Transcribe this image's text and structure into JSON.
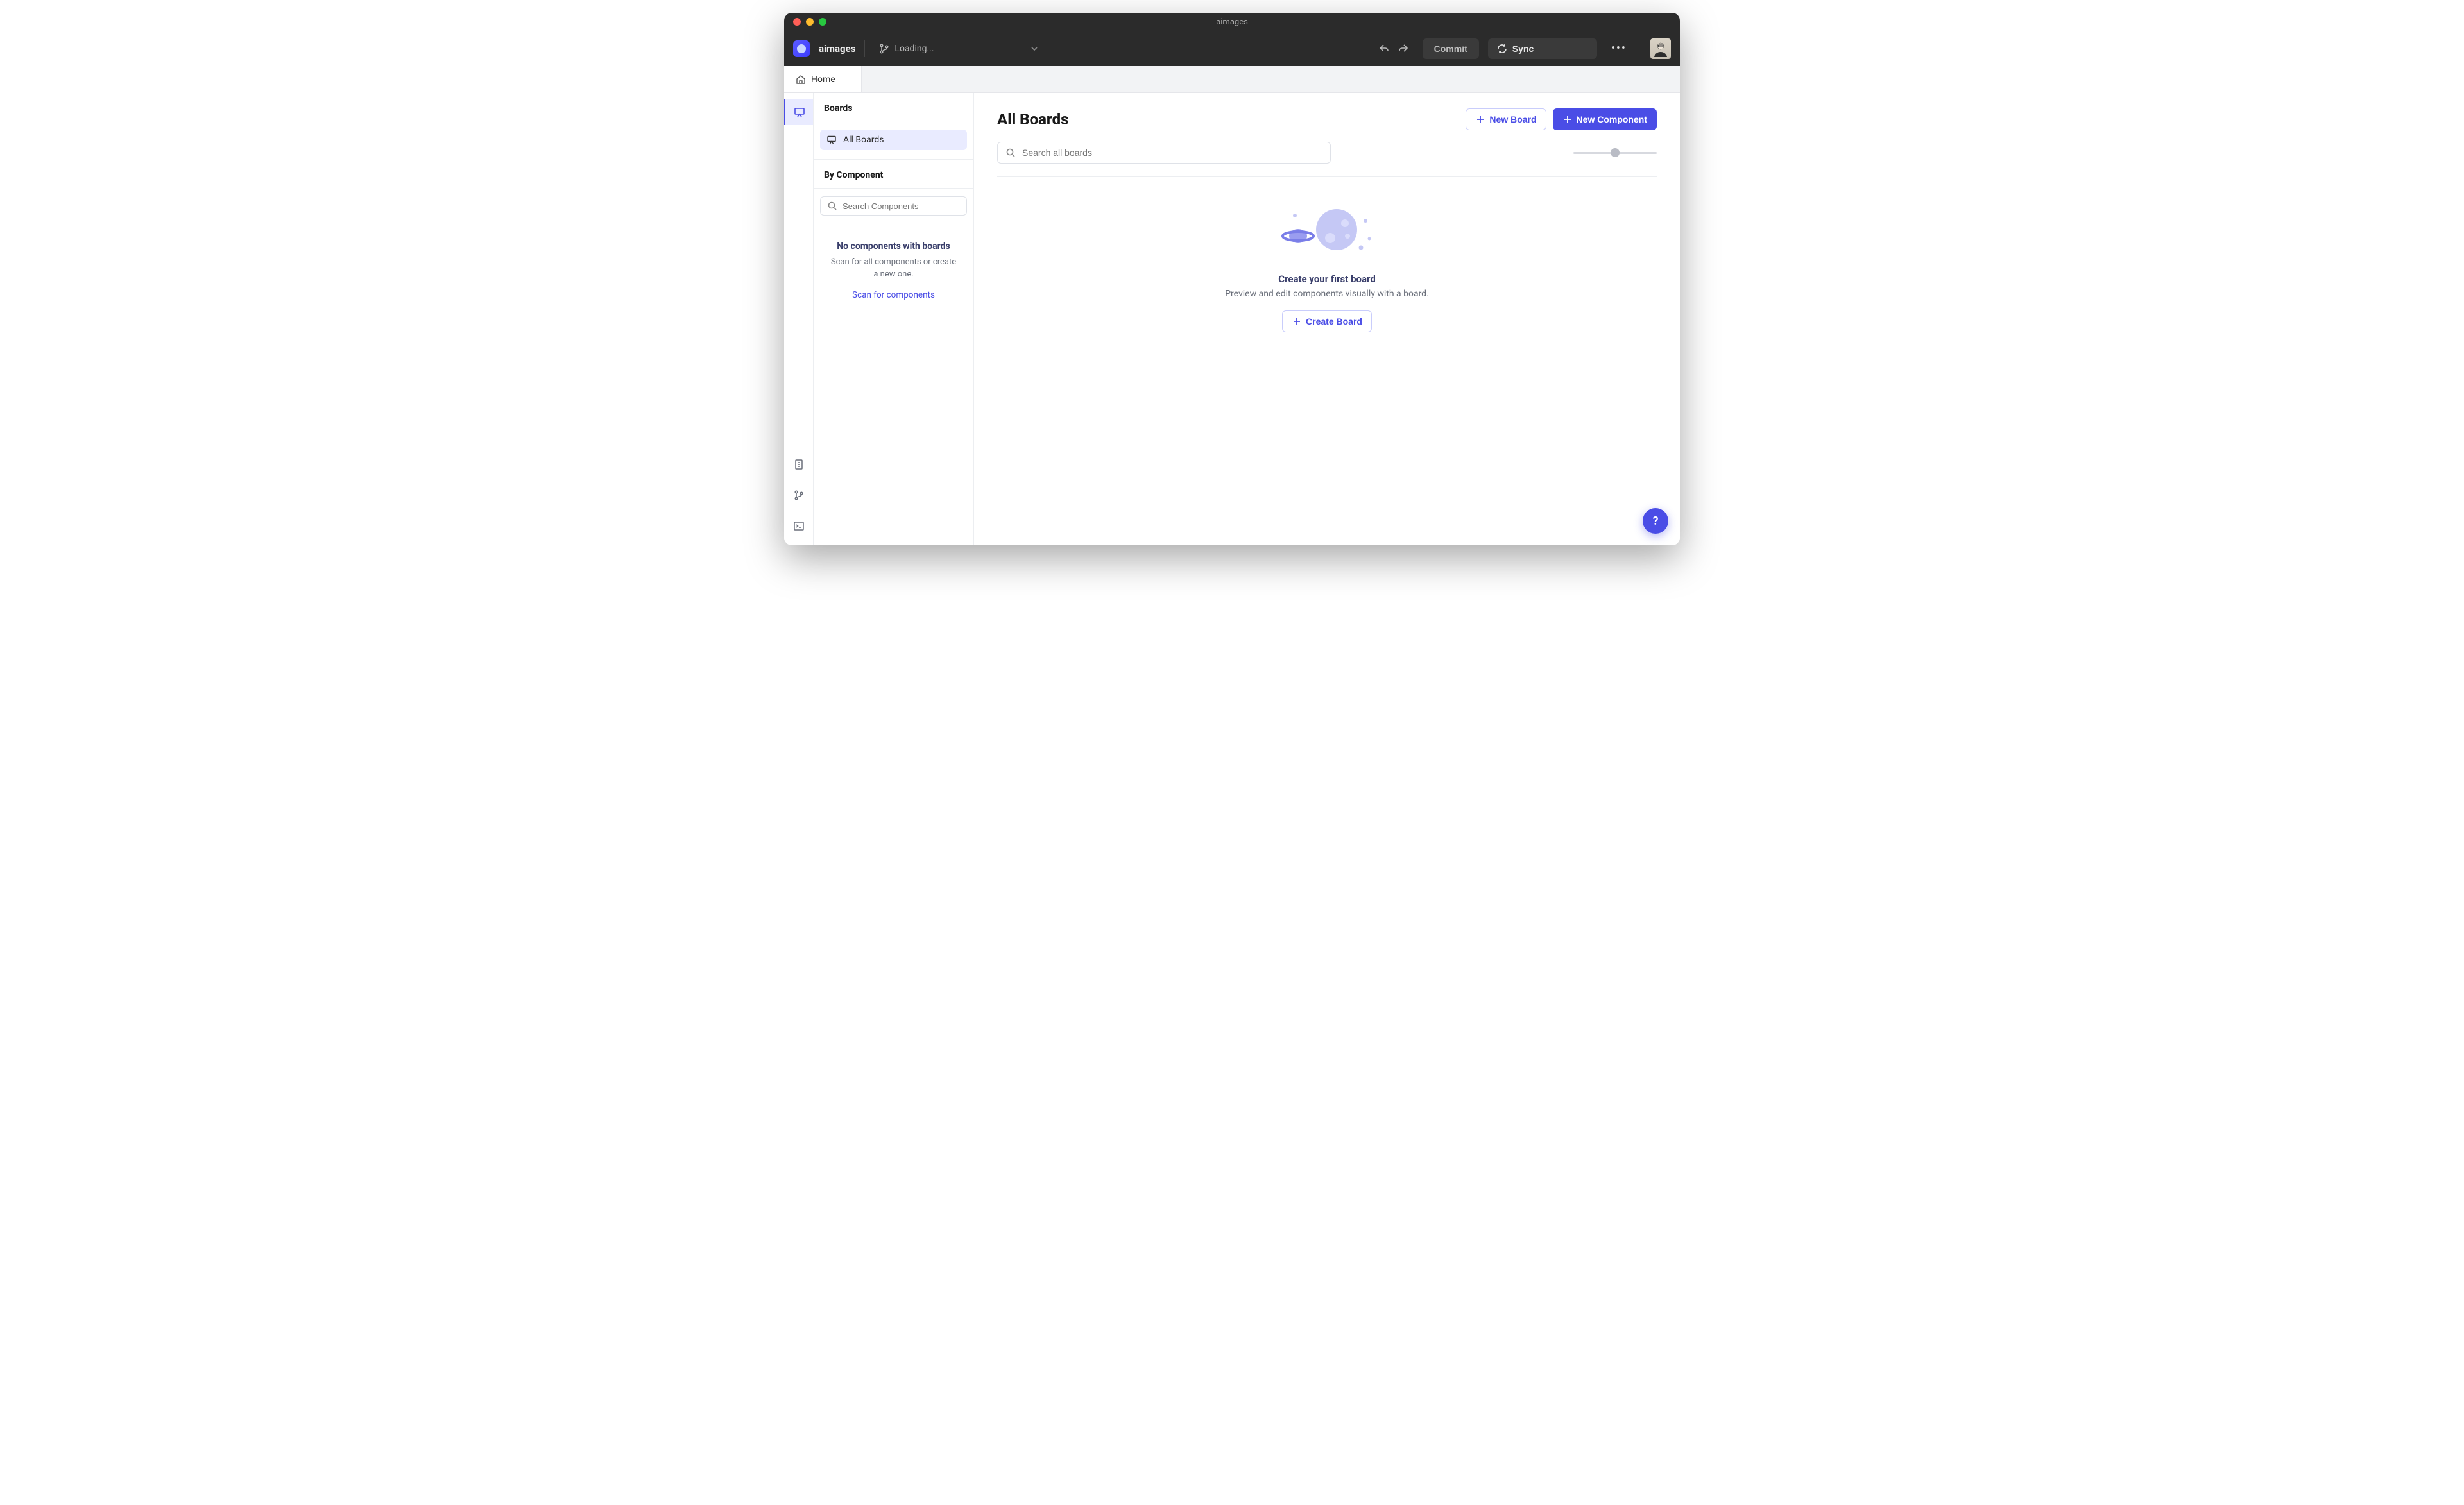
{
  "window": {
    "title": "aimages"
  },
  "toolbar": {
    "app_name": "aimages",
    "branch_status": "Loading...",
    "commit_label": "Commit",
    "sync_label": "Sync"
  },
  "tabs": {
    "home": "Home"
  },
  "sidebar": {
    "header": "Boards",
    "all_boards": "All Boards",
    "by_component": "By Component",
    "search_placeholder": "Search Components",
    "empty_title": "No components with boards",
    "empty_body": "Scan for all components or create a new one.",
    "scan_link": "Scan for components"
  },
  "main": {
    "title": "All Boards",
    "new_board": "New Board",
    "new_component": "New Component",
    "search_placeholder": "Search all boards",
    "empty_title": "Create your first board",
    "empty_sub": "Preview and edit components visually with a board.",
    "create_board": "Create Board"
  },
  "help": {
    "label": "?"
  }
}
